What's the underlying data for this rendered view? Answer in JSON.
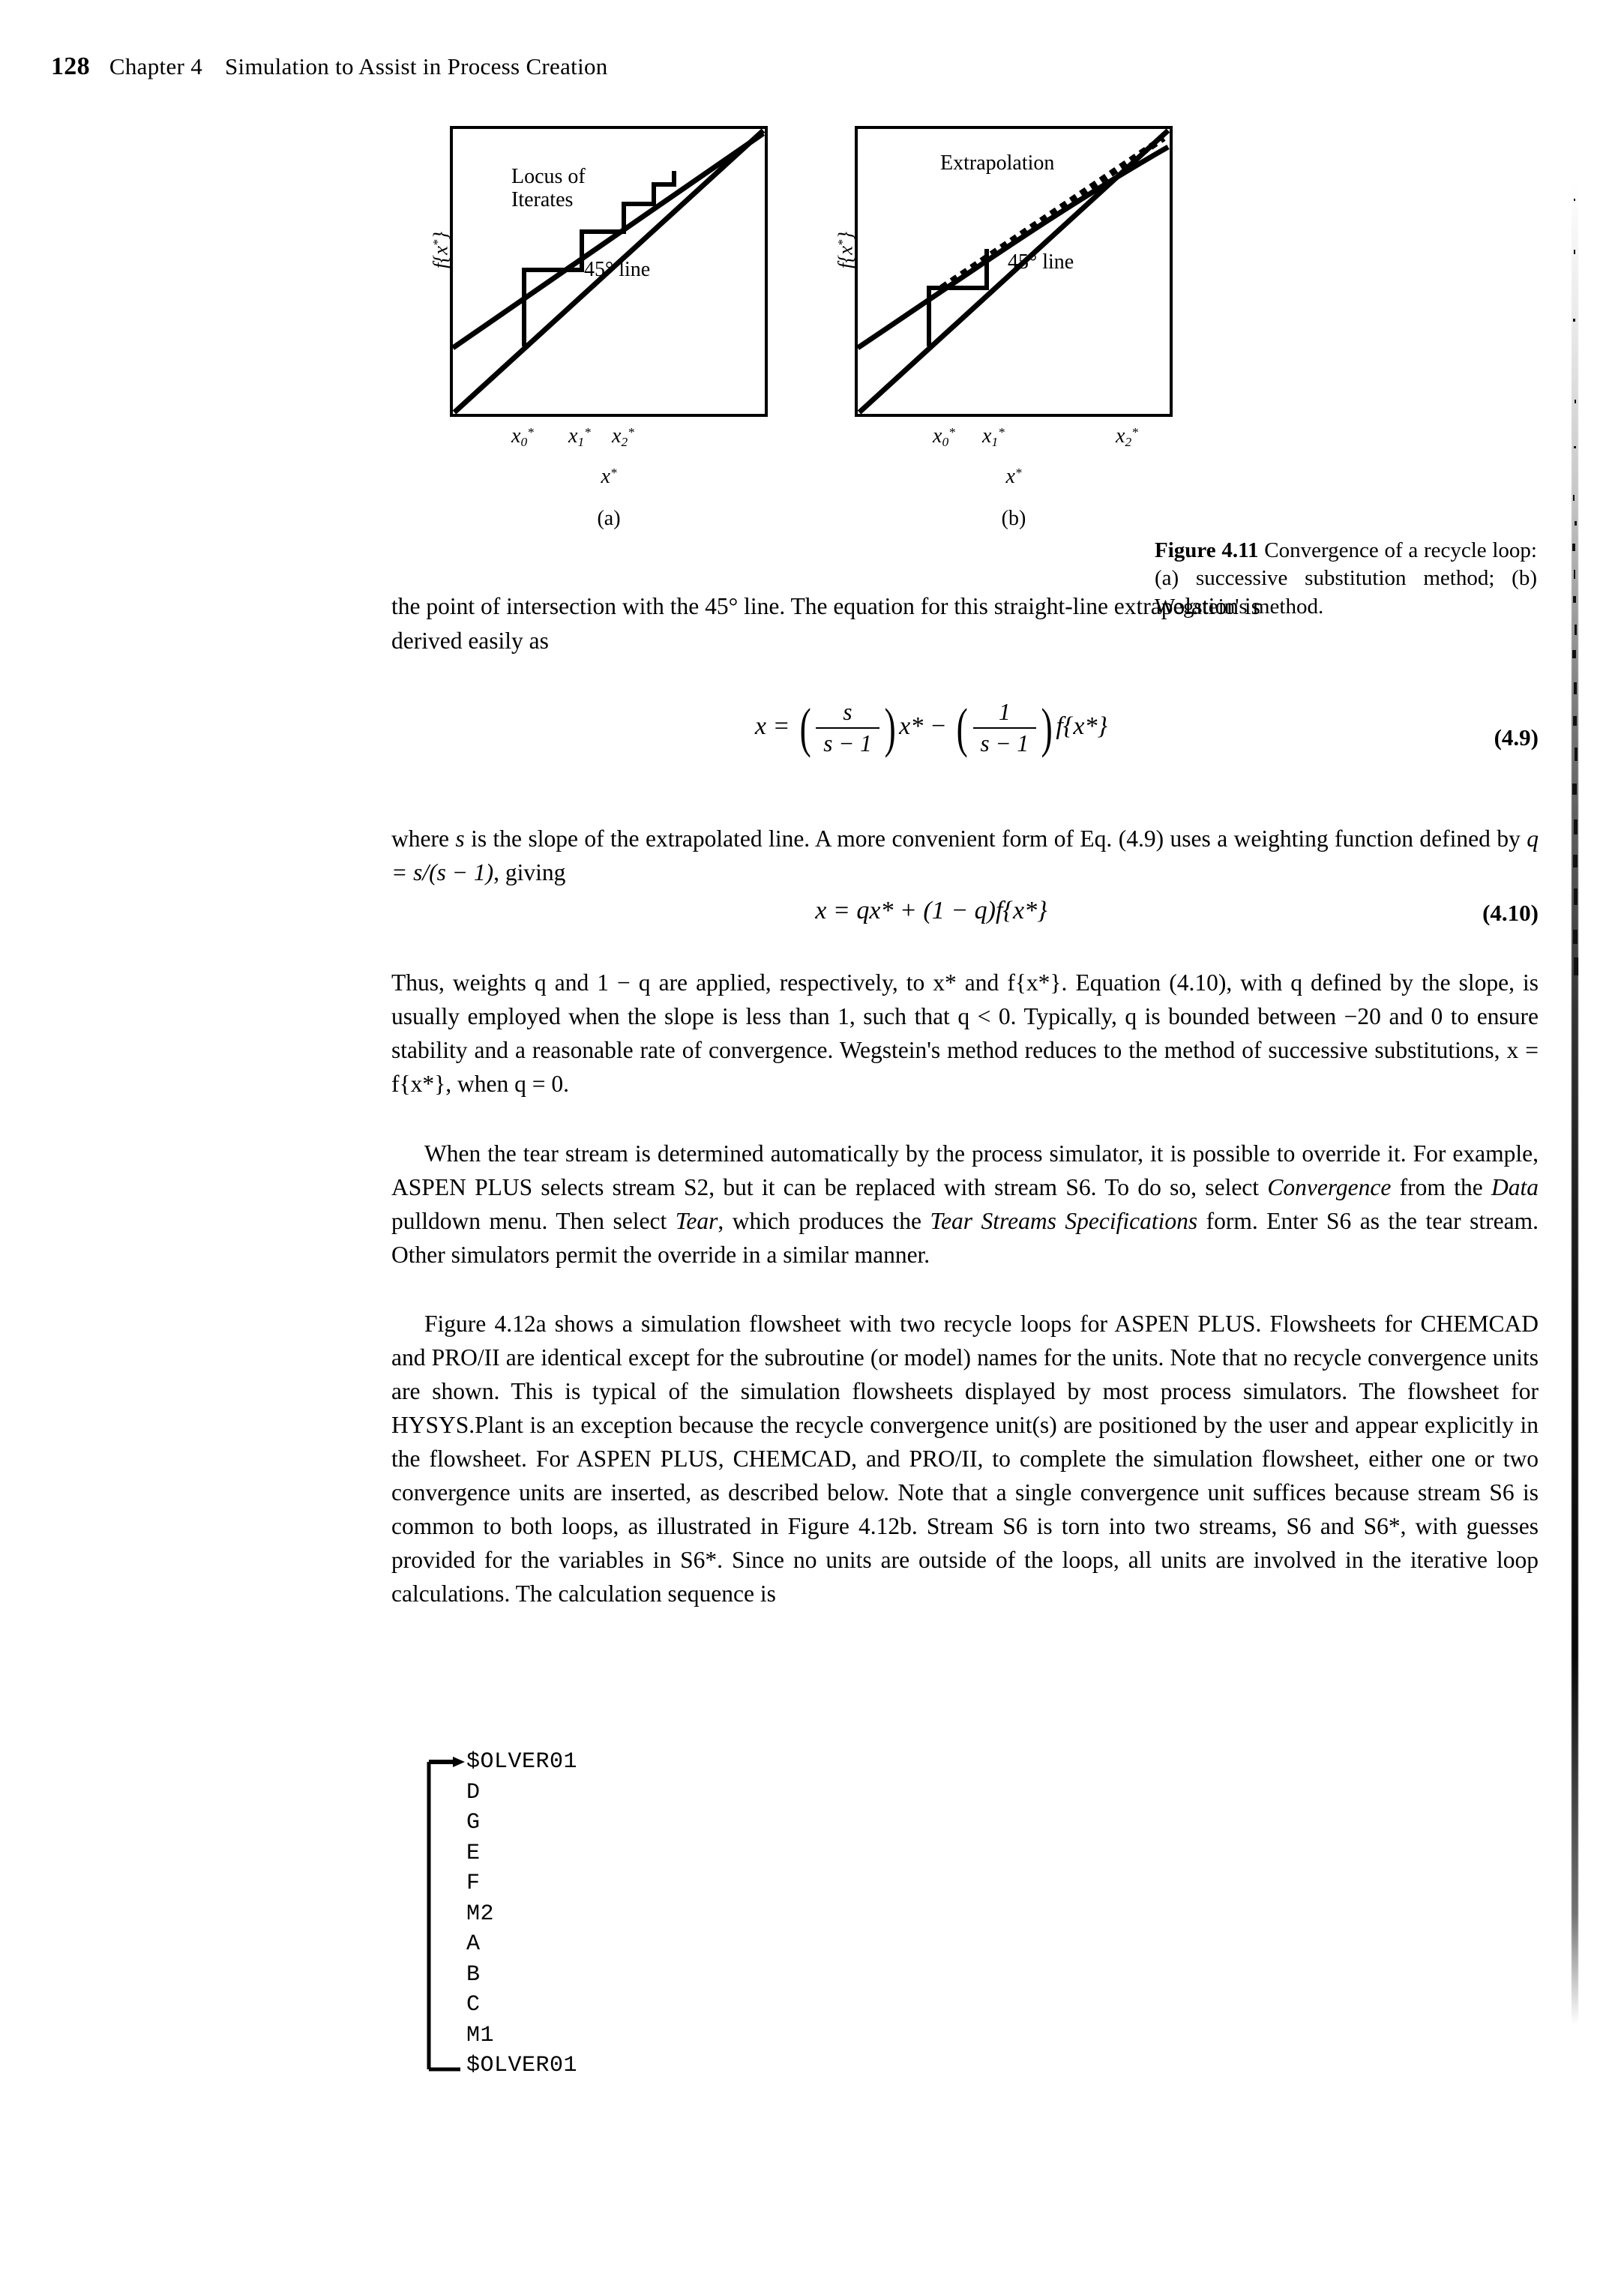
{
  "running_head": {
    "page_number": "128",
    "chapter": "Chapter 4",
    "title": "Simulation to Assist in Process Creation"
  },
  "figure": {
    "caption_lead": "Figure 4.11",
    "caption_text": " Convergence of a recycle loop: (a) successive substitution method; (b) Wegstein's method.",
    "panels": [
      {
        "name": "(a)",
        "y_axis_label": "f{x*}",
        "x_axis_label": "x*",
        "annotation_1": "Locus of",
        "annotation_2": "Iterates",
        "annotation_3": "45° line",
        "tick_labels": [
          "x′0*",
          "x″1*",
          "x″2*"
        ],
        "tick_bases": [
          "x",
          "x",
          "x"
        ],
        "tick_subs": [
          "0",
          "1",
          "2"
        ]
      },
      {
        "name": "(b)",
        "y_axis_label": "f{x*}",
        "x_axis_label": "x*",
        "annotation_1": "Extrapolation",
        "annotation_3": "45° line",
        "tick_bases": [
          "x",
          "x",
          "x"
        ],
        "tick_subs": [
          "0",
          "1",
          "2"
        ]
      }
    ]
  },
  "body": {
    "p1_line1": "the point of intersection with the 45° line. The equation for this straight-line extrapolation is",
    "p1_line2": "derived easily as",
    "eq_49_number": "(4.9)",
    "eq_49_lhs": "x =",
    "eq_49_frac1_num": "s",
    "eq_49_frac1_den": "s − 1",
    "eq_49_mid": "x*  −",
    "eq_49_frac2_num": "1",
    "eq_49_frac2_den": "s − 1",
    "eq_49_tail": "f{x*}",
    "p2_part_a": "where ",
    "p2_s": "s",
    "p2_part_b": " is the slope of the extrapolated line. A more convenient form of Eq. (4.9) uses a weighting function defined by ",
    "p2_q_def": "q = s/(s − 1)",
    "p2_part_c": ", giving",
    "eq_410_number": "(4.10)",
    "eq_410_body": "x = qx* + (1 − q)f{x*}",
    "p3": "Thus, weights q and 1 − q are applied, respectively, to x* and f{x*}. Equation (4.10), with q defined by the slope, is usually employed when the slope is less than 1, such that q < 0. Typically, q is bounded between −20 and 0 to ensure stability and a reasonable rate of convergence. Wegstein's method reduces to the method of successive substitutions, x = f{x*}, when q = 0.",
    "p4_a": "When the tear stream is determined automatically by the process simulator, it is possible to override it. For example, ASPEN PLUS selects stream S2, but it can be replaced with stream S6. To do so, select ",
    "p4_convergence": "Convergence",
    "p4_b": " from the ",
    "p4_data": "Data",
    "p4_c": " pulldown menu. Then select ",
    "p4_tear": "Tear",
    "p4_d": ", which produces the ",
    "p4_form": "Tear Streams Specifications",
    "p4_e": " form. Enter S6 as the tear stream. Other simulators permit the override in a similar manner.",
    "p5": "Figure 4.12a shows a simulation flowsheet with two recycle loops for ASPEN PLUS. Flowsheets for CHEMCAD and PRO/II are identical except for the subroutine (or model) names for the units. Note that no recycle convergence units are shown. This is typical of the simulation flowsheets displayed by most process simulators. The flowsheet for HYSYS.Plant is an exception because the recycle convergence unit(s) are positioned by the user and appear explicitly in the flowsheet. For ASPEN PLUS, CHEMCAD, and PRO/II, to complete the simulation flowsheet, either one or two convergence units are inserted, as described below. Note that a single convergence unit suffices because stream S6 is common to both loops, as illustrated in Figure 4.12b. Stream S6 is torn into two streams, S6 and S6*, with guesses provided for the variables in S6*. Since no units are outside of the loops, all units are involved in the iterative loop calculations. The calculation sequence is"
  },
  "sequence": {
    "items": [
      "$OLVER01",
      "D",
      "G",
      "E",
      "F",
      "M2",
      "A",
      "B",
      "C",
      "M1",
      "$OLVER01"
    ]
  },
  "colors": {
    "ink": "#000000",
    "paper": "#ffffff"
  }
}
